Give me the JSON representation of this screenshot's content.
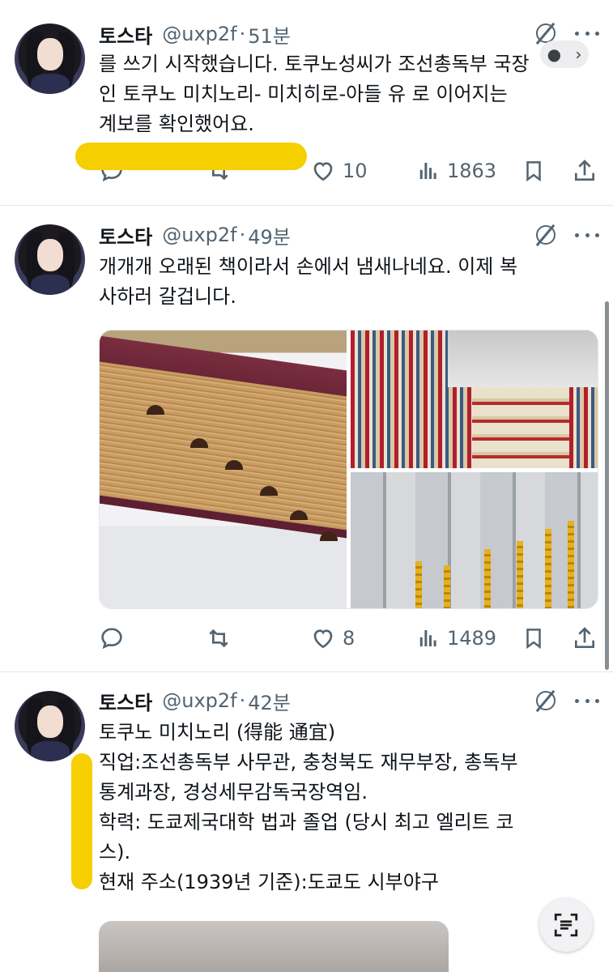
{
  "tweets": [
    {
      "name": "토스타",
      "handle": "@uxp2f",
      "time": "51분",
      "lines": [
        "를 쓰기 시작했습니다. 토쿠노성씨가 조선총독부 국장",
        "인 토쿠노 미치노리- 미치히로-아들 유 로 이어지는",
        "계보를 확인했어요."
      ],
      "likes": "10",
      "views": "1863"
    },
    {
      "name": "토스타",
      "handle": "@uxp2f",
      "time": "49분",
      "lines": [
        "개개개 오래된 책이라서 손에서 냄새나네요. 이제 복",
        "사하러 갈겁니다."
      ],
      "likes": "8",
      "views": "1489"
    },
    {
      "name": "토스타",
      "handle": "@uxp2f",
      "time": "42분",
      "lines": [
        "토쿠노 미치노리 (得能 通宜)",
        "직업:조선총독부 사무관, 충청북도 재무부장, 총독부",
        "통계과장, 경성세무감독국장역임.",
        "학력: 도쿄제국대학 법과 졸업 (당시 최고 엘리트 코",
        "스).",
        "현재 주소(1939년 기준):도쿄도 시부야구"
      ]
    }
  ],
  "icons": {
    "grok": "grok-icon",
    "more": "more-icon",
    "reply": "reply-icon",
    "retweet": "retweet-icon",
    "like": "like-icon",
    "views": "views-icon",
    "bookmark": "bookmark-icon",
    "share": "share-icon",
    "scan": "text-scan-icon"
  },
  "colors": {
    "text": "#0f1419",
    "muted": "#536471",
    "highlight": "#f6cf00"
  }
}
